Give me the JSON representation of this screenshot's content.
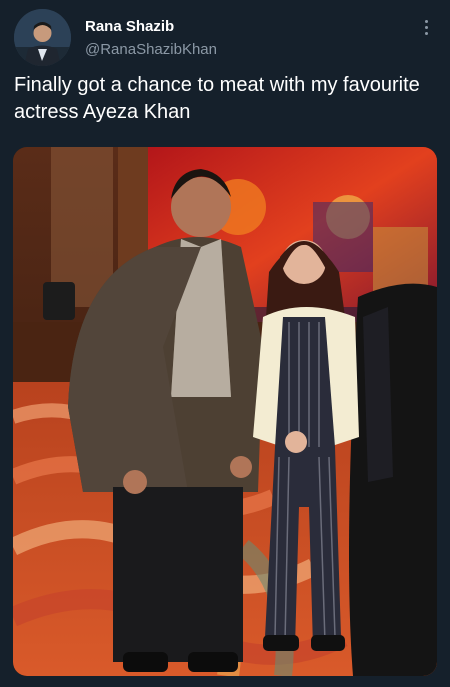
{
  "tweet": {
    "display_name": "Rana Shazib",
    "handle": "@RanaShazibKhan",
    "text": "Finally got a chance to meat with my favourite actress Ayeza Khan"
  },
  "icons": {
    "more": "more-horizontal-icon"
  },
  "colors": {
    "background": "#15202b",
    "primary_text": "#ffffff",
    "secondary_text": "#8b98a5"
  }
}
